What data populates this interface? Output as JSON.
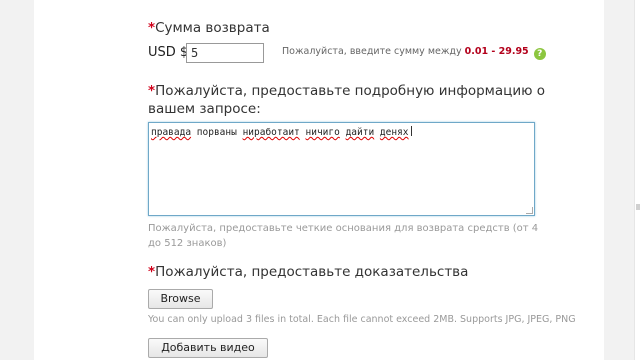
{
  "refund_amount": {
    "label": "Сумма возврата",
    "currency": "USD $",
    "value": "5",
    "hint_prefix": "Пожалуйста, введите сумму между",
    "range": "0.01 - 29.95",
    "help_icon": "question-circle-icon"
  },
  "details": {
    "label": "Пожалуйста, предоставьте подробную информацию о вашем запросе:",
    "text_words": [
      "правада",
      "порваны",
      "ниработаит",
      "ничиго",
      "дайти",
      "денях"
    ],
    "misspelled": [
      true,
      false,
      true,
      true,
      true,
      true
    ],
    "hint": "Пожалуйста, предоставьте четкие основания для возврата средств (от 4 до 512 знаков)"
  },
  "evidence": {
    "label": "Пожалуйста, предоставьте доказательства",
    "browse_label": "Browse",
    "upload_hint": "You can only upload 3 files in total. Each file cannot exceed 2MB. Supports JPG, JPEG, PNG",
    "add_video_label": "Добавить видео"
  },
  "required_mark": "*",
  "colors": {
    "required": "#d0021b",
    "range": "#b3001b",
    "help_icon": "#8cc63f"
  }
}
